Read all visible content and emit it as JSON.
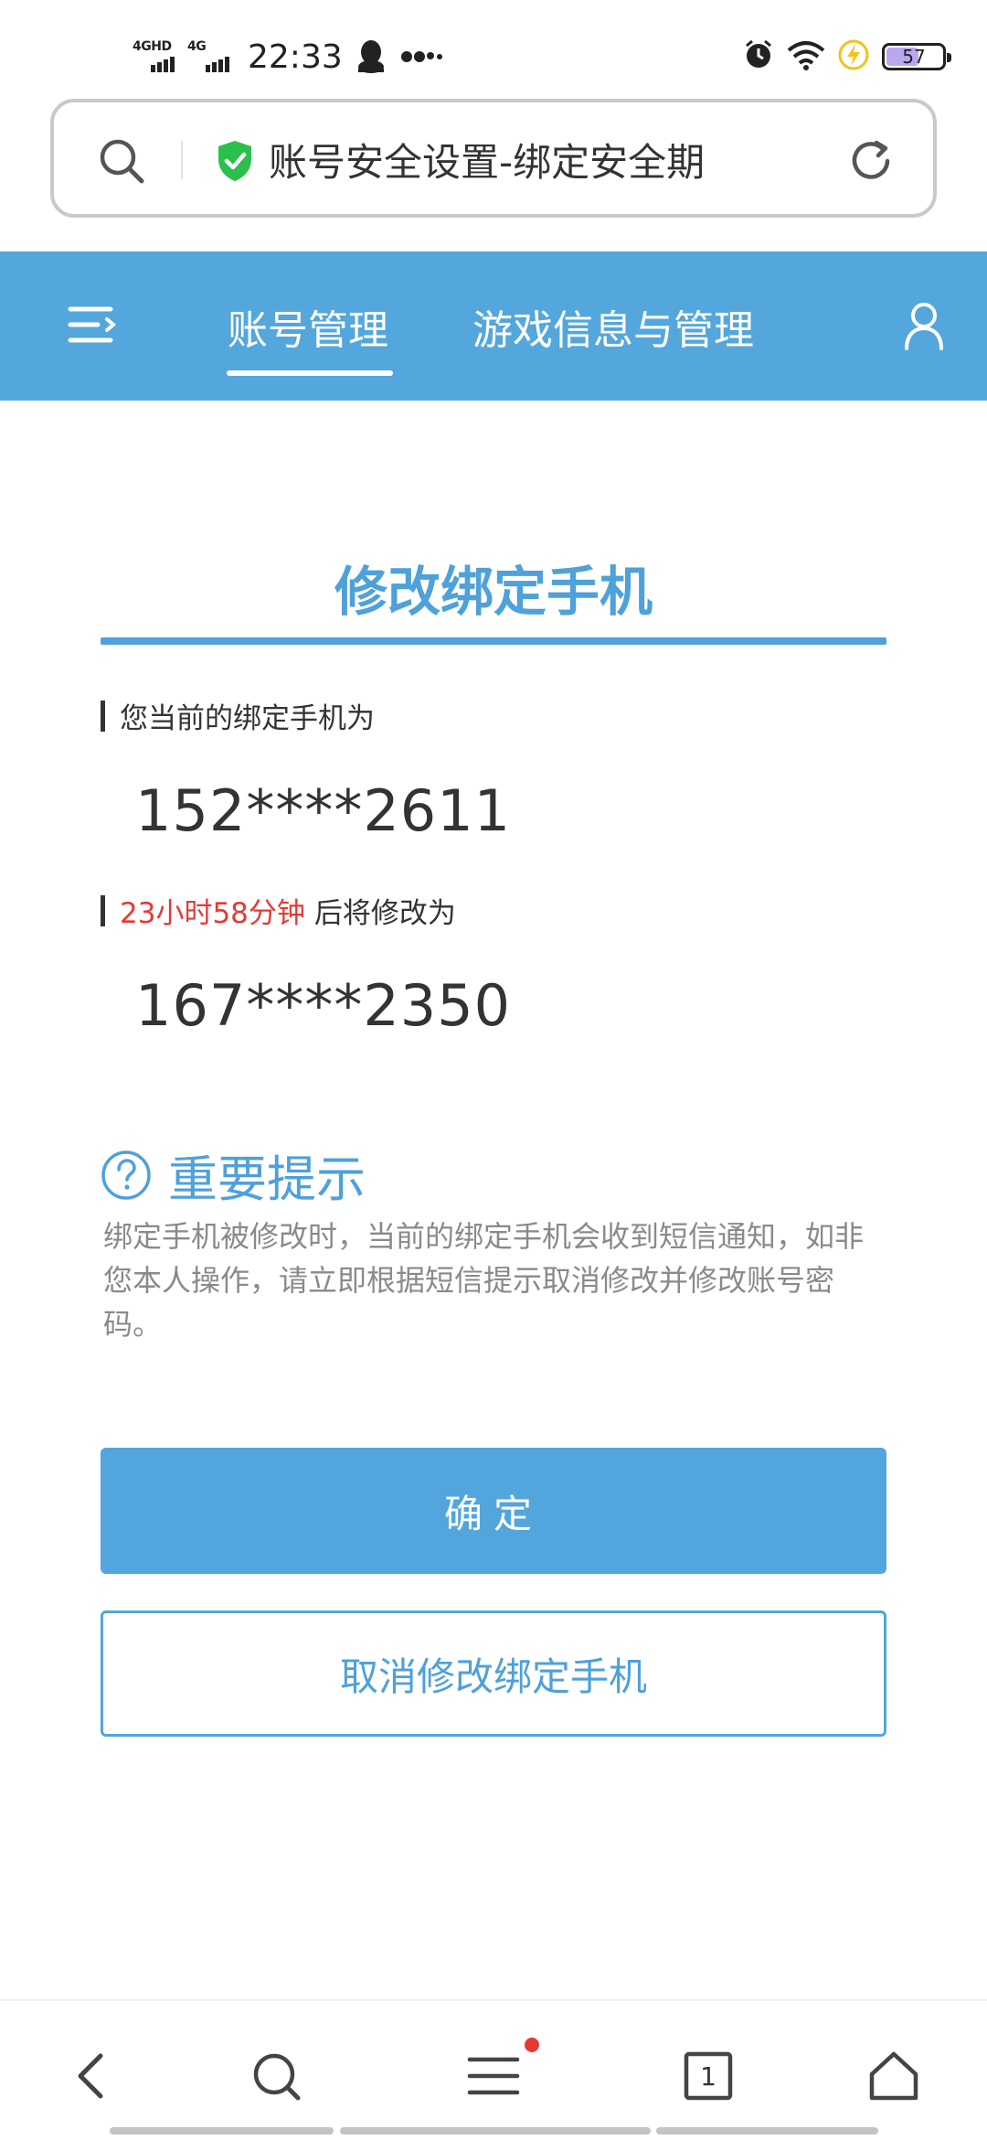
{
  "status_bar": {
    "signal1_label": "4GHD",
    "signal2_label": "4G",
    "time": "22:33",
    "battery_level": "57",
    "icons": [
      "qq-penguin-icon",
      "more-dots-icon",
      "alarm-icon",
      "wifi-icon",
      "charging-icon",
      "battery-icon"
    ]
  },
  "address_bar": {
    "title": "账号安全设置-绑定安全期",
    "shield_color": "#2bbf4e"
  },
  "nav": {
    "tabs": [
      {
        "label": "账号管理",
        "active": true
      },
      {
        "label": "游戏信息与管理",
        "active": false
      }
    ],
    "color": "#53a7dc"
  },
  "main": {
    "section_title": "修改绑定手机",
    "current_label": "您当前的绑定手机为",
    "current_phone": "152****2611",
    "countdown": "23小时58分钟",
    "change_label": "后将修改为",
    "new_phone": "167****2350",
    "tip_title": "重要提示",
    "tip_text": "绑定手机被修改时，当前的绑定手机会收到短信通知，如非您本人操作，请立即根据短信提示取消修改并修改账号密码。",
    "confirm_label": "确定",
    "cancel_label": "取消修改绑定手机",
    "accent_color": "#4ea1d9",
    "warning_color": "#e53935"
  },
  "bottom_bar": {
    "tab_count": "1"
  }
}
